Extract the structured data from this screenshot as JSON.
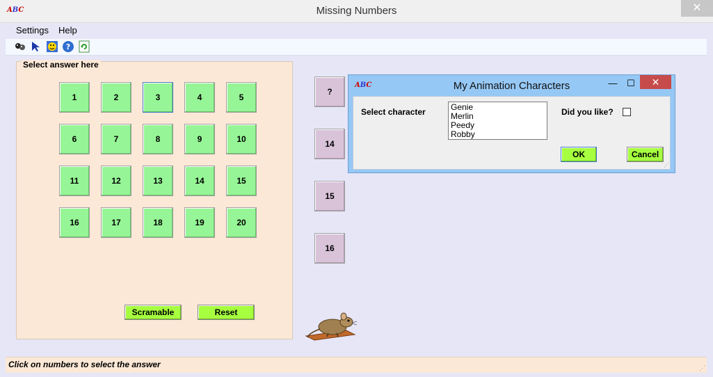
{
  "window": {
    "title": "Missing Numbers",
    "close_glyph": "✕"
  },
  "menu": {
    "items": [
      "Settings",
      "Help"
    ]
  },
  "toolbar": {
    "icons": [
      "characters-icon",
      "cursor-icon",
      "smiley-icon",
      "help-icon",
      "refresh-icon"
    ]
  },
  "answer_panel": {
    "label": "Select answer here",
    "numbers": [
      "1",
      "2",
      "3",
      "4",
      "5",
      "6",
      "7",
      "8",
      "9",
      "10",
      "11",
      "12",
      "13",
      "14",
      "15",
      "16",
      "17",
      "18",
      "19",
      "20"
    ],
    "selected": "3",
    "scramble_label": "Scramable",
    "reset_label": "Reset"
  },
  "sequence": {
    "boxes": [
      "?",
      "14",
      "15",
      "16"
    ]
  },
  "dialog": {
    "title": "My Animation Characters",
    "select_label": "Select character",
    "characters": [
      "Genie",
      "Merlin",
      "Peedy",
      "Robby"
    ],
    "like_label": "Did you like?",
    "liked": false,
    "ok_label": "OK",
    "cancel_label": "Cancel",
    "minimize_glyph": "—",
    "maximize_glyph": "☐",
    "close_glyph": "✕"
  },
  "status": {
    "text": "Click on numbers to select the answer"
  },
  "colors": {
    "number_button": "#96f596",
    "action_button": "#a6ff3f",
    "sequence_box": "#d9c3d9",
    "panel": "#fbe8d6",
    "dialog_frame": "#96c8f5"
  }
}
